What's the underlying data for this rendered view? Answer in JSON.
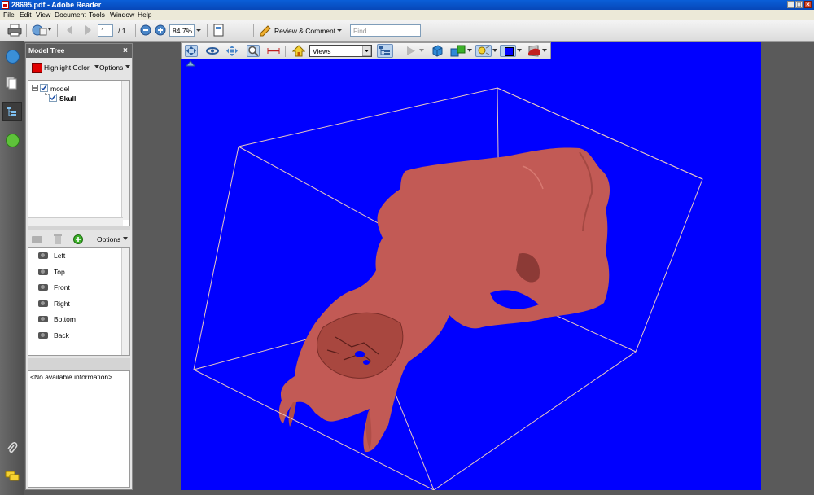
{
  "window": {
    "title": "28695.pdf - Adobe Reader"
  },
  "menu": [
    "File",
    "Edit",
    "View",
    "Document",
    "Tools",
    "Window",
    "Help"
  ],
  "toolbar": {
    "page_current": "1",
    "page_total": "/ 1",
    "zoom": "84.7%",
    "review_label": "Review & Comment",
    "find_placeholder": "Find"
  },
  "panel": {
    "title": "Model Tree",
    "highlight_label": "Highlight Color",
    "highlight_color": "#e00000",
    "options_label": "Options",
    "tree": [
      {
        "label": "model"
      },
      {
        "label": "Skull"
      }
    ],
    "views_options_label": "Options",
    "views": [
      "Left",
      "Top",
      "Front",
      "Right",
      "Bottom",
      "Back"
    ],
    "info": "<No available information>"
  },
  "viewer3d": {
    "views_dropdown": "Views",
    "background_color": "#0000ff",
    "model_color": "#c25a55"
  }
}
